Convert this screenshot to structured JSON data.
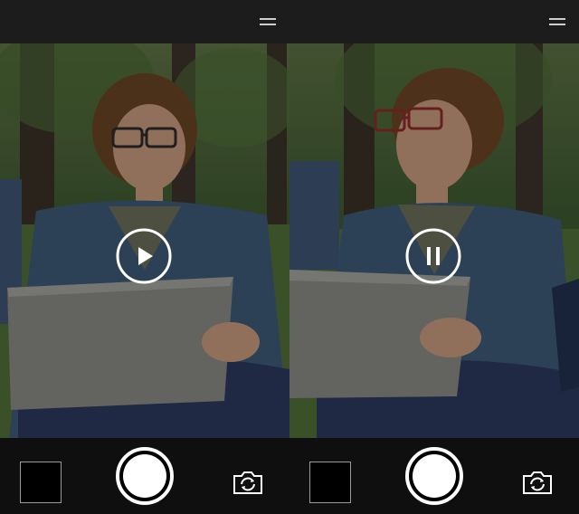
{
  "left_pane": {
    "menu_icon": "hamburger-menu-icon",
    "playback_control": "play-icon",
    "state": "paused"
  },
  "right_pane": {
    "menu_icon": "hamburger-menu-icon",
    "playback_control": "pause-icon",
    "state": "playing"
  },
  "controls": {
    "shutter_icon": "shutter-icon",
    "gallery_icon": "gallery-thumbnail-icon",
    "switch_camera_icon": "switch-camera-icon"
  },
  "colors": {
    "bar": "#1c1c1c",
    "bottom": "#0f0f0f",
    "accent": "#ffffff",
    "grass": "#4f6f3a",
    "cardigan": "#3f5a78",
    "jeans": "#2c3a5e",
    "laptop": "#8a8a86"
  }
}
